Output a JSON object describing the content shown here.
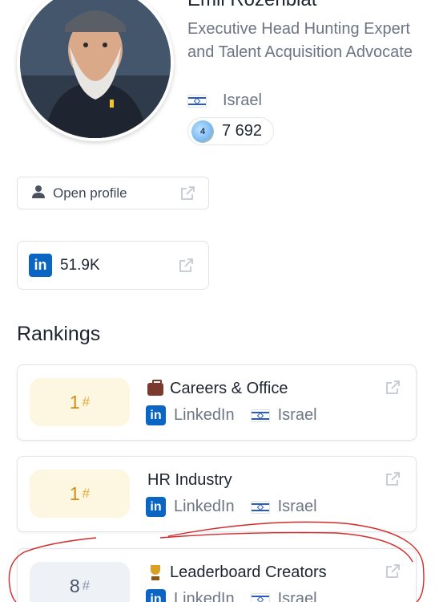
{
  "profile": {
    "name": "Emil Rozenblat",
    "headline": "Executive Head Hunting Expert and Talent Acquisition Advocate",
    "country": "Israel",
    "score": "7 692",
    "score_badge": "4"
  },
  "actions": {
    "open_profile_label": "Open profile",
    "followers": "51.9K"
  },
  "rankings": {
    "title": "Rankings",
    "items": [
      {
        "rank": "1",
        "hash": "#",
        "title": "Careers & Office",
        "platform": "LinkedIn",
        "country": "Israel",
        "emoji": "briefcase-icon",
        "style": "gold"
      },
      {
        "rank": "1",
        "hash": "#",
        "title": "HR Industry",
        "platform": "LinkedIn",
        "country": "Israel",
        "emoji": "",
        "style": "gold"
      },
      {
        "rank": "8",
        "hash": "#",
        "title": "Leaderboard Creators",
        "platform": "LinkedIn",
        "country": "Israel",
        "emoji": "trophy-icon",
        "style": "grey"
      }
    ]
  },
  "colors": {
    "linkedin": "#0a66c2",
    "gold_rank": "#d78a12",
    "annotation": "#d42a2a"
  }
}
